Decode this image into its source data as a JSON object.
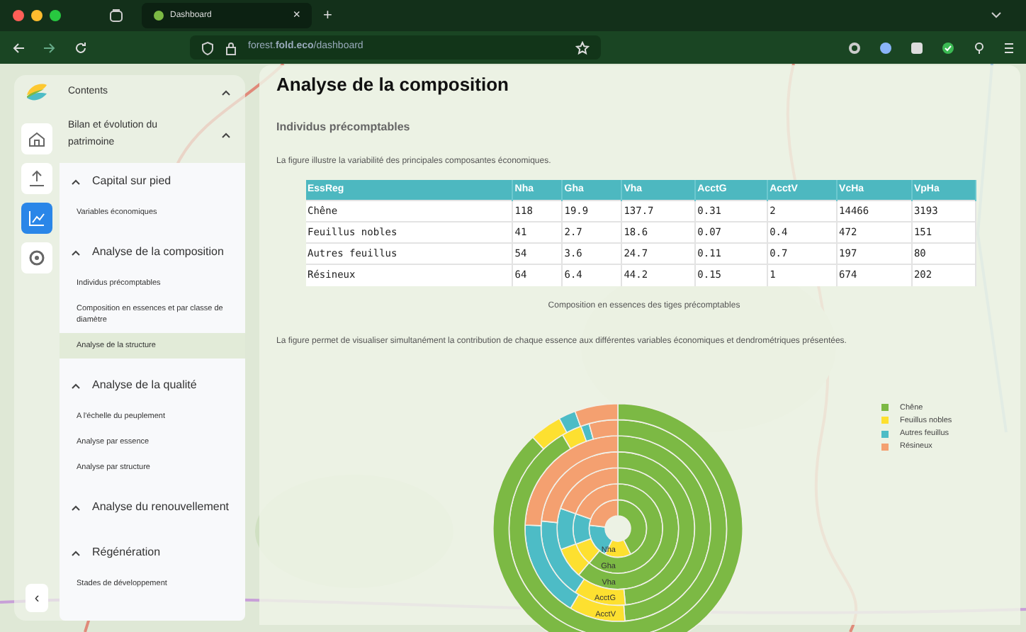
{
  "browser": {
    "tab": {
      "title": "Dashboard",
      "close": "×"
    },
    "new_tab": "+",
    "url": "forest.**fold.eco**/dashboard"
  },
  "rail": {
    "items": [
      {
        "kind": "home",
        "selected": false
      },
      {
        "kind": "upload",
        "selected": false
      },
      {
        "kind": "chart",
        "selected": true
      },
      {
        "kind": "settings",
        "selected": false
      }
    ],
    "collapse": "‹"
  },
  "sidebar": {
    "title": "Contents",
    "chapter": "Bilan et évolution du patrimoine",
    "sections": [
      {
        "title": "Capital sur pied",
        "expanded": true,
        "items": [
          {
            "label": "Variables économiques",
            "selected": false
          }
        ]
      },
      {
        "title": "Analyse de la composition",
        "expanded": true,
        "items": [
          {
            "label": "Individus précomptables",
            "selected": false
          },
          {
            "label": "Composition en essences et par classe de diamètre",
            "selected": false
          },
          {
            "label": "Analyse de la structure",
            "selected": true
          }
        ]
      },
      {
        "title": "Analyse de la qualité",
        "expanded": true,
        "items": [
          {
            "label": "A l'échelle du peuplement",
            "selected": false
          },
          {
            "label": "Analyse par essence",
            "selected": false
          },
          {
            "label": "Analyse par structure",
            "selected": false
          }
        ]
      },
      {
        "title": "Analyse du renouvellement",
        "expanded": true
      },
      {
        "title": "Régénération",
        "expanded": true,
        "items": [
          {
            "label": "Stades de développement",
            "selected": false
          }
        ]
      }
    ]
  },
  "main": {
    "title": "Analyse de la composition",
    "subtitle": "Individus précomptables",
    "intro": "La figure illustre la variabilité des principales composantes économiques.",
    "table": {
      "columns": [
        "EssReg",
        "Nha",
        "Gha",
        "Vha",
        "AcctG",
        "AcctV",
        "VcHa",
        "VpHa"
      ],
      "rows": [
        [
          "Chêne",
          "118",
          "19.9",
          "137.7",
          "0.31",
          "2",
          "14466",
          "3193"
        ],
        [
          "Feuillus nobles",
          "41",
          "2.7",
          "18.6",
          "0.07",
          "0.4",
          "472",
          "151"
        ],
        [
          "Autres feuillus",
          "54",
          "3.6",
          "24.7",
          "0.11",
          "0.7",
          "197",
          "80"
        ],
        [
          "Résineux",
          "64",
          "6.4",
          "44.2",
          "0.15",
          "1",
          "674",
          "202"
        ]
      ]
    },
    "caption": "Composition en essences des tiges précomptables",
    "chart_intro": "La figure permet de visualiser simultanément la contribution de chaque essence aux différentes variables économiques et dendrométriques présentées.",
    "chart": {
      "ring_labels": [
        "Nha",
        "Gha",
        "Vha",
        "AcctG",
        "AcctV"
      ],
      "legend": [
        {
          "label": "Chêne",
          "color": "#7cb944"
        },
        {
          "label": "Feuillus nobles",
          "color": "#fde030"
        },
        {
          "label": "Autres feuillus",
          "color": "#4dbcc6"
        },
        {
          "label": "Résineux",
          "color": "#f4a070"
        }
      ]
    }
  }
}
